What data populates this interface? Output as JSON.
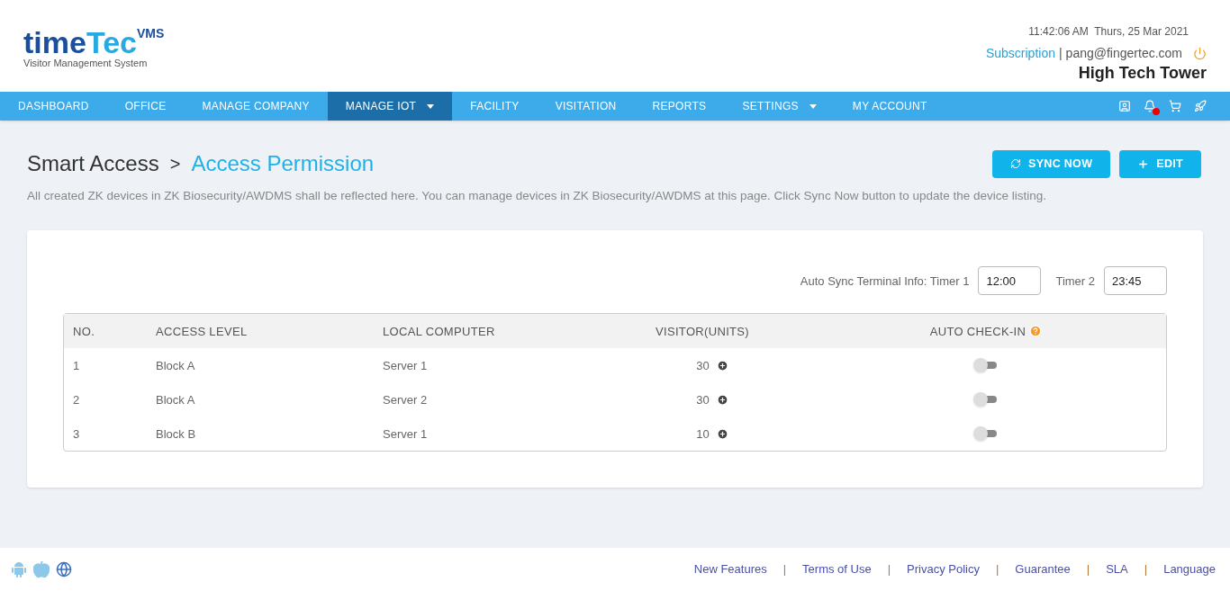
{
  "logo": {
    "part_1": "time",
    "part_2": "Tec",
    "badge": "VMS",
    "tagline": "Visitor Management System"
  },
  "header": {
    "datetime": "11:42:06 AM  Thurs, 25 Mar 2021",
    "subscription": "Subscription",
    "separator": "|",
    "email": "pang@fingertec.com",
    "building": "High Tech Tower"
  },
  "nav": [
    {
      "label": "DASHBOARD",
      "selected": false,
      "dropdown": false
    },
    {
      "label": "OFFICE",
      "selected": false,
      "dropdown": false
    },
    {
      "label": "MANAGE COMPANY",
      "selected": false,
      "dropdown": false
    },
    {
      "label": "MANAGE IOT",
      "selected": true,
      "dropdown": true
    },
    {
      "label": "FACILITY",
      "selected": false,
      "dropdown": false
    },
    {
      "label": "VISITATION",
      "selected": false,
      "dropdown": false
    },
    {
      "label": "REPORTS",
      "selected": false,
      "dropdown": false
    },
    {
      "label": "SETTINGS",
      "selected": false,
      "dropdown": true
    },
    {
      "label": "MY ACCOUNT",
      "selected": false,
      "dropdown": false
    }
  ],
  "breadcrumb": {
    "parent": "Smart Access",
    "separator": ">",
    "current": "Access Permission"
  },
  "actions": [
    "SYNC NOW",
    "EDIT"
  ],
  "description": "All created ZK devices in ZK Biosecurity/AWDMS shall be reflected here. You can manage devices in ZK Biosecurity/AWDMS at this page. Click Sync Now button to update the device listing.",
  "auto_sync": {
    "label": "Auto Sync Terminal Info: Timer 1",
    "timer_1": "12:00",
    "timer_2_label": "Timer 2",
    "timer_2": "23:45"
  },
  "table": {
    "columns": [
      "NO.",
      "ACCESS LEVEL",
      "LOCAL COMPUTER",
      "VISITOR(UNITS)",
      "AUTO CHECK-IN"
    ],
    "rows": [
      {
        "no": "1",
        "access_level": "Block A",
        "local_computer": "Server 1",
        "visitor_units": "30",
        "auto_check_in": false
      },
      {
        "no": "2",
        "access_level": "Block A",
        "local_computer": "Server 2",
        "visitor_units": "30",
        "auto_check_in": false
      },
      {
        "no": "3",
        "access_level": "Block B",
        "local_computer": "Server 1",
        "visitor_units": "10",
        "auto_check_in": false
      }
    ]
  },
  "footer": {
    "separator": "|",
    "links": [
      "New Features",
      "Terms of Use",
      "Privacy Policy",
      "Guarantee",
      "SLA",
      "Language"
    ]
  }
}
